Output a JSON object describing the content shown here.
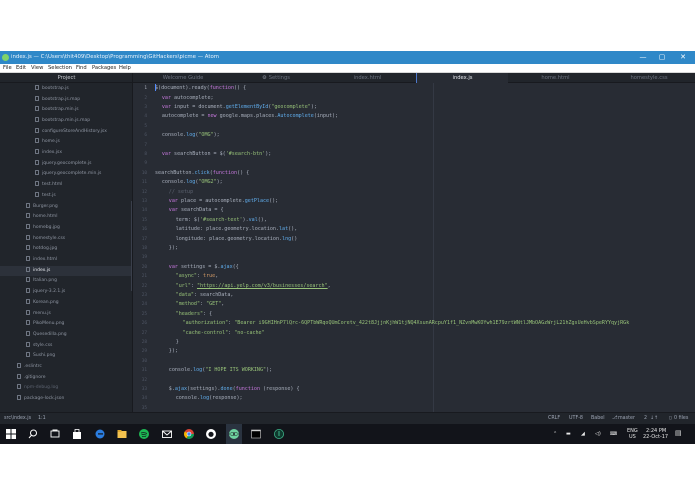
{
  "window": {
    "title": "index.js — C:\\Users\\thit409\\Desktop\\Programming\\GitHackers\\picme — Atom",
    "controls": [
      "—",
      "▢",
      "✕"
    ]
  },
  "menu": [
    "File",
    "Edit",
    "View",
    "Selection",
    "Find",
    "Packages",
    "Help"
  ],
  "tree": {
    "header": "Project",
    "items": [
      {
        "label": "bootstrap.js",
        "level": 2
      },
      {
        "label": "bootstrap.js.map",
        "level": 2
      },
      {
        "label": "bootstrap.min.js",
        "level": 2
      },
      {
        "label": "bootstrap.min.js.map",
        "level": 2
      },
      {
        "label": "configureStoreAndHistory.jsx",
        "level": 2
      },
      {
        "label": "home.js",
        "level": 2
      },
      {
        "label": "index.jsx",
        "level": 2
      },
      {
        "label": "jquery.geocomplete.js",
        "level": 2
      },
      {
        "label": "jquery.geocomplete.min.js",
        "level": 2
      },
      {
        "label": "test.html",
        "level": 2
      },
      {
        "label": "test.js",
        "level": 2
      },
      {
        "label": "Burger.png",
        "level": 1
      },
      {
        "label": "home.html",
        "level": 1
      },
      {
        "label": "homebg.jpg",
        "level": 1
      },
      {
        "label": "homestyle.css",
        "level": 1
      },
      {
        "label": "hotdog.jpg",
        "level": 1
      },
      {
        "label": "index.html",
        "level": 1
      },
      {
        "label": "index.js",
        "level": 1,
        "selected": true
      },
      {
        "label": "Italian.png",
        "level": 1
      },
      {
        "label": "jquery-3.2.1.js",
        "level": 1
      },
      {
        "label": "Korean.png",
        "level": 1
      },
      {
        "label": "menu.js",
        "level": 1
      },
      {
        "label": "PikoMenu.png",
        "level": 1
      },
      {
        "label": "Quesedilla.png",
        "level": 1
      },
      {
        "label": "style.css",
        "level": 1
      },
      {
        "label": "Sushi.png",
        "level": 1
      },
      {
        "label": ".eslintrc",
        "level": 0
      },
      {
        "label": ".gitignore",
        "level": 0
      },
      {
        "label": "npm-debug.log",
        "level": 0,
        "dim": true
      },
      {
        "label": "package-lock.json",
        "level": 0
      }
    ]
  },
  "tabs": [
    {
      "label": "Welcome Guide"
    },
    {
      "label": "Settings",
      "icon": "gear-icon"
    },
    {
      "label": "index.html"
    },
    {
      "label": "index.js",
      "active": true
    },
    {
      "label": "home.html"
    },
    {
      "label": "homestyle.css"
    }
  ],
  "colors": {
    "keyword": "#c678dd",
    "function": "#61afef",
    "string": "#98c379",
    "property": "#e06c75",
    "number": "#d19a66",
    "comment": "#5c6370",
    "plain": "#abb2bf",
    "operator": "#56b6c2",
    "accent": "#2f88c8"
  },
  "code": [
    {
      "n": 1,
      "indent": 0,
      "tokens": [
        [
          "$(document).ready(",
          "plain"
        ],
        [
          "function",
          "keyword"
        ],
        [
          "() {",
          "plain"
        ]
      ]
    },
    {
      "n": 2,
      "indent": 1,
      "tokens": [
        [
          "var ",
          "keyword"
        ],
        [
          "autocomplete;",
          "plain"
        ]
      ]
    },
    {
      "n": 3,
      "indent": 1,
      "tokens": [
        [
          "var ",
          "keyword"
        ],
        [
          "input = document.",
          "plain"
        ],
        [
          "getElementById",
          "function"
        ],
        [
          "(",
          "plain"
        ],
        [
          "\"geocomplete\"",
          "string"
        ],
        [
          ");",
          "plain"
        ]
      ]
    },
    {
      "n": 4,
      "indent": 1,
      "tokens": [
        [
          "autocomplete = ",
          "plain"
        ],
        [
          "new ",
          "keyword"
        ],
        [
          "google.maps.places.",
          "plain"
        ],
        [
          "Autocomplete",
          "function"
        ],
        [
          "(input);",
          "plain"
        ]
      ]
    },
    {
      "n": 5,
      "indent": 0,
      "tokens": []
    },
    {
      "n": 6,
      "indent": 1,
      "tokens": [
        [
          "console.",
          "plain"
        ],
        [
          "log",
          "function"
        ],
        [
          "(",
          "plain"
        ],
        [
          "\"OMG\"",
          "string"
        ],
        [
          ");",
          "plain"
        ]
      ]
    },
    {
      "n": 7,
      "indent": 0,
      "tokens": []
    },
    {
      "n": 8,
      "indent": 1,
      "tokens": [
        [
          "var ",
          "keyword"
        ],
        [
          "searchButton = $(",
          "plain"
        ],
        [
          "'#search-btn'",
          "string"
        ],
        [
          ");",
          "plain"
        ]
      ]
    },
    {
      "n": 9,
      "indent": 0,
      "tokens": []
    },
    {
      "n": 10,
      "indent": 0,
      "tokens": [
        [
          "searchButton.",
          "plain"
        ],
        [
          "click",
          "function"
        ],
        [
          "(",
          "plain"
        ],
        [
          "function",
          "keyword"
        ],
        [
          "() {",
          "plain"
        ]
      ]
    },
    {
      "n": 11,
      "indent": 1,
      "tokens": [
        [
          "console.",
          "plain"
        ],
        [
          "log",
          "function"
        ],
        [
          "(",
          "plain"
        ],
        [
          "\"OMG2\"",
          "string"
        ],
        [
          ");",
          "plain"
        ]
      ]
    },
    {
      "n": 12,
      "indent": 2,
      "tokens": [
        [
          "// setup",
          "comment"
        ]
      ]
    },
    {
      "n": 13,
      "indent": 2,
      "tokens": [
        [
          "var ",
          "keyword"
        ],
        [
          "place = autocomplete.",
          "plain"
        ],
        [
          "getPlace",
          "function"
        ],
        [
          "();",
          "plain"
        ]
      ]
    },
    {
      "n": 14,
      "indent": 2,
      "tokens": [
        [
          "var ",
          "keyword"
        ],
        [
          "searchData = {",
          "plain"
        ]
      ]
    },
    {
      "n": 15,
      "indent": 3,
      "tokens": [
        [
          "term: $(",
          "plain"
        ],
        [
          "'#search-text'",
          "string"
        ],
        [
          ").",
          "plain"
        ],
        [
          "val",
          "function"
        ],
        [
          "(),",
          "plain"
        ]
      ]
    },
    {
      "n": 16,
      "indent": 3,
      "tokens": [
        [
          "latitude: place.geometry.location.",
          "plain"
        ],
        [
          "lat",
          "function"
        ],
        [
          "(),",
          "plain"
        ]
      ]
    },
    {
      "n": 17,
      "indent": 3,
      "tokens": [
        [
          "longitude: place.geometry.location.",
          "plain"
        ],
        [
          "lng",
          "function"
        ],
        [
          "()",
          "plain"
        ]
      ]
    },
    {
      "n": 18,
      "indent": 2,
      "tokens": [
        [
          "});",
          "plain"
        ]
      ]
    },
    {
      "n": 19,
      "indent": 0,
      "tokens": []
    },
    {
      "n": 20,
      "indent": 2,
      "tokens": [
        [
          "var ",
          "keyword"
        ],
        [
          "settings = $.",
          "plain"
        ],
        [
          "ajax",
          "function"
        ],
        [
          "({",
          "plain"
        ]
      ]
    },
    {
      "n": 21,
      "indent": 3,
      "tokens": [
        [
          "\"async\"",
          "string"
        ],
        [
          ": ",
          "plain"
        ],
        [
          "true",
          "number"
        ],
        [
          ",",
          "plain"
        ]
      ]
    },
    {
      "n": 22,
      "indent": 3,
      "tokens": [
        [
          "\"url\"",
          "string"
        ],
        [
          ": ",
          "plain"
        ],
        [
          "\"https://api.yelp.com/v3/businesses/search\"",
          "string"
        ],
        [
          ",",
          "plain"
        ]
      ]
    },
    {
      "n": 23,
      "indent": 3,
      "tokens": [
        [
          "\"data\"",
          "string"
        ],
        [
          ": searchData,",
          "plain"
        ]
      ]
    },
    {
      "n": 24,
      "indent": 3,
      "tokens": [
        [
          "\"method\"",
          "string"
        ],
        [
          ": ",
          "plain"
        ],
        [
          "\"GET\"",
          "string"
        ],
        [
          ",",
          "plain"
        ]
      ]
    },
    {
      "n": 25,
      "indent": 3,
      "tokens": [
        [
          "\"headers\"",
          "string"
        ],
        [
          ": {",
          "plain"
        ]
      ]
    },
    {
      "n": 26,
      "indent": 4,
      "tokens": [
        [
          "\"authorization\"",
          "string"
        ],
        [
          ": ",
          "plain"
        ],
        [
          "\"Bearer i9GHIHnP7lQrc-6QPTbWRqoQUmCoretv_422t8JjjnKjhW1tjNQ4XsunARcpuY1f1_NZvnMwKOYwh1E79zrtWNtlJMbOAGzWrjL21hZgsUeHvbSpeRYYqyjRGk",
          "string"
        ]
      ]
    },
    {
      "n": 27,
      "indent": 4,
      "tokens": [
        [
          "\"cache-control\"",
          "string"
        ],
        [
          ": ",
          "plain"
        ],
        [
          "\"no-cache\"",
          "string"
        ]
      ]
    },
    {
      "n": 28,
      "indent": 3,
      "tokens": [
        [
          "}",
          "plain"
        ]
      ]
    },
    {
      "n": 29,
      "indent": 2,
      "tokens": [
        [
          "});",
          "plain"
        ]
      ]
    },
    {
      "n": 30,
      "indent": 0,
      "tokens": []
    },
    {
      "n": 31,
      "indent": 2,
      "tokens": [
        [
          "console.",
          "plain"
        ],
        [
          "log",
          "function"
        ],
        [
          "(",
          "plain"
        ],
        [
          "\"I HOPE ITS WORKING\"",
          "string"
        ],
        [
          ");",
          "plain"
        ]
      ]
    },
    {
      "n": 32,
      "indent": 0,
      "tokens": []
    },
    {
      "n": 33,
      "indent": 2,
      "tokens": [
        [
          "$.",
          "plain"
        ],
        [
          "ajax",
          "function"
        ],
        [
          "(settings).",
          "plain"
        ],
        [
          "done",
          "function"
        ],
        [
          "(",
          "plain"
        ],
        [
          "function",
          "keyword"
        ],
        [
          " (response) {",
          "plain"
        ]
      ]
    },
    {
      "n": 34,
      "indent": 3,
      "tokens": [
        [
          "console.",
          "plain"
        ],
        [
          "log",
          "function"
        ],
        [
          "(response);",
          "plain"
        ]
      ]
    },
    {
      "n": 35,
      "indent": 0,
      "tokens": []
    }
  ],
  "status": {
    "path": "src\\index.js",
    "cursor": "1:1",
    "line_ending": "CRLF",
    "encoding": "UTF-8",
    "grammar": "Babel",
    "branch": "master",
    "git_counts": "2",
    "files": "0 files"
  },
  "taskbar": {
    "lang_top": "ENG",
    "lang_bottom": "US",
    "time": "2:24 PM",
    "date": "22-Oct-17"
  }
}
